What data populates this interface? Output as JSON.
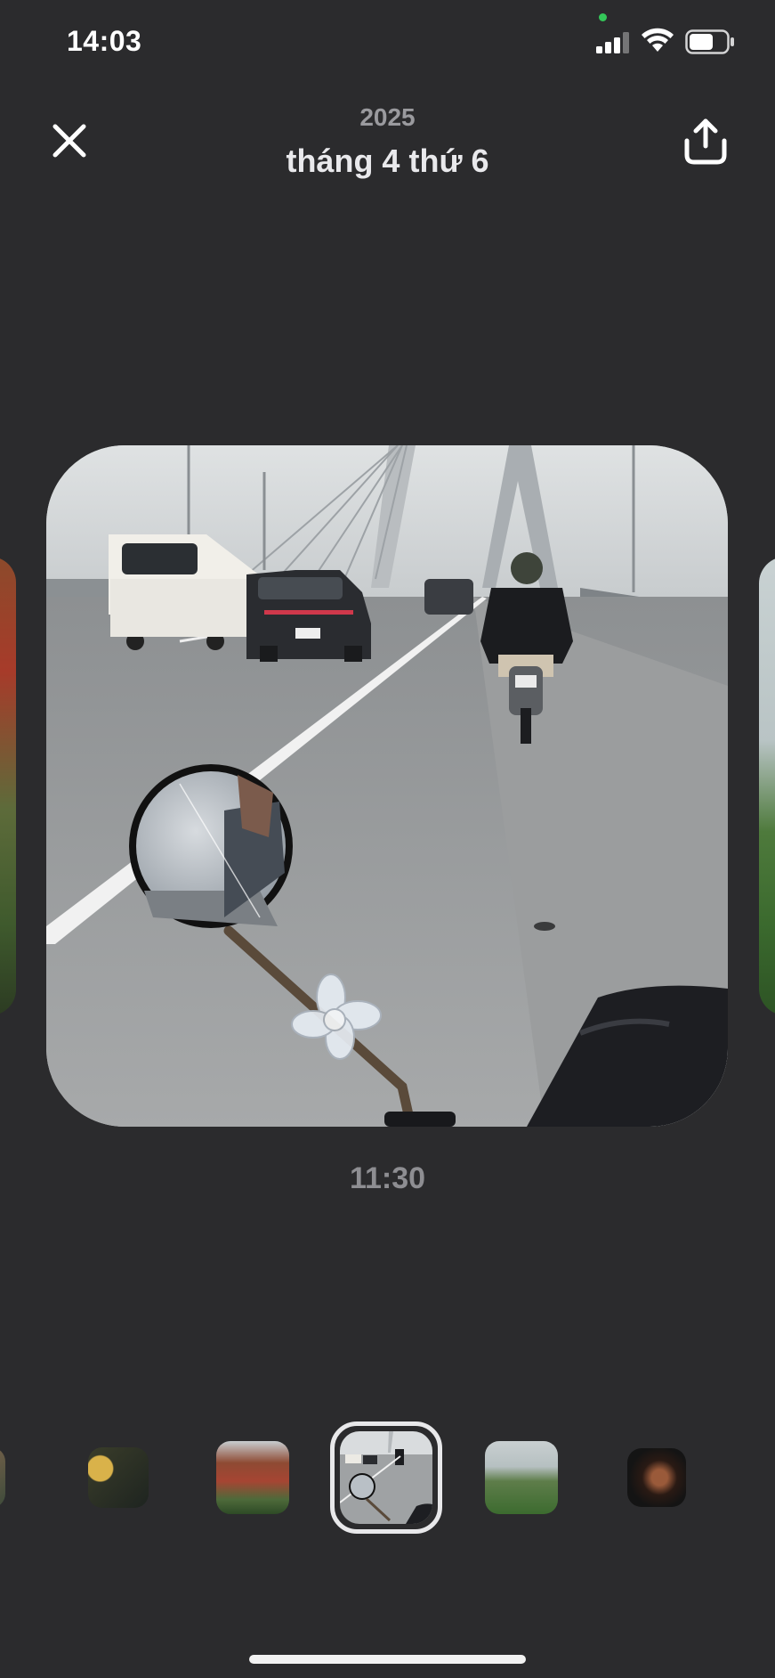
{
  "status_bar": {
    "time": "14:03",
    "icons": [
      "signal-icon",
      "wifi-icon",
      "battery-icon"
    ]
  },
  "header": {
    "close_icon": "close-icon",
    "share_icon": "share-icon",
    "year": "2025",
    "date": "tháng 4 thứ 6"
  },
  "photo": {
    "time": "11:30"
  },
  "thumbnails": [
    {
      "name": "thumbnail-1"
    },
    {
      "name": "thumbnail-2"
    },
    {
      "name": "thumbnail-3"
    },
    {
      "name": "thumbnail-4",
      "selected": true
    },
    {
      "name": "thumbnail-5"
    },
    {
      "name": "thumbnail-6"
    }
  ],
  "colors": {
    "background": "#2b2b2d",
    "selection_border": "#e8e8ea",
    "camera_indicator": "#34c759"
  }
}
